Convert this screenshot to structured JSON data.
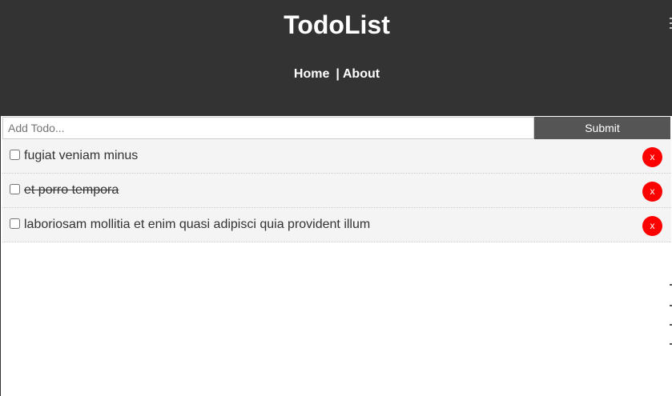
{
  "header": {
    "title": "TodoList",
    "nav": {
      "home_label": "Home",
      "separator": "|",
      "about_label": "About"
    }
  },
  "add_form": {
    "placeholder": "Add Todo...",
    "value": "",
    "submit_label": "Submit"
  },
  "todos": [
    {
      "title": "fugiat veniam minus",
      "completed": false,
      "delete_label": "x"
    },
    {
      "title": "et porro tempora",
      "completed": true,
      "delete_label": "x"
    },
    {
      "title": "laboriosam mollitia et enim quasi adipisci quia provident illum",
      "completed": false,
      "delete_label": "x"
    }
  ],
  "colors": {
    "header_bg": "#333333",
    "submit_bg": "#555555",
    "item_bg": "#f4f4f4",
    "delete_bg": "#ff0000"
  }
}
